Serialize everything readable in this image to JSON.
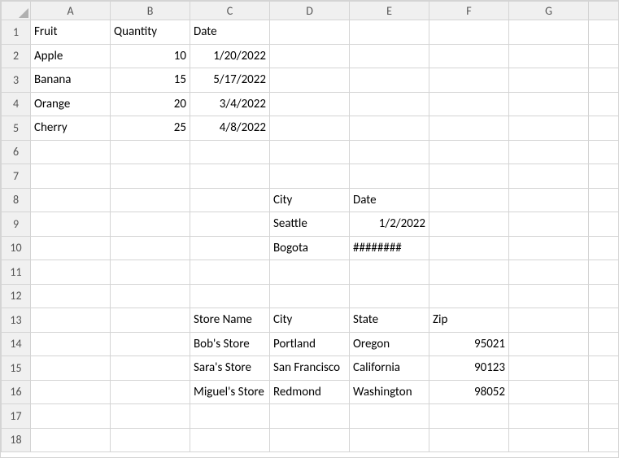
{
  "columns": [
    "A",
    "B",
    "C",
    "D",
    "E",
    "F",
    "G"
  ],
  "rows": 18,
  "cells": {
    "A1": {
      "v": "Fruit",
      "a": "txt"
    },
    "B1": {
      "v": "Quantity",
      "a": "txt"
    },
    "C1": {
      "v": "Date",
      "a": "txt"
    },
    "A2": {
      "v": "Apple",
      "a": "txt"
    },
    "B2": {
      "v": "10",
      "a": "num"
    },
    "C2": {
      "v": "1/20/2022",
      "a": "num"
    },
    "A3": {
      "v": "Banana",
      "a": "txt"
    },
    "B3": {
      "v": "15",
      "a": "num"
    },
    "C3": {
      "v": "5/17/2022",
      "a": "num"
    },
    "A4": {
      "v": "Orange",
      "a": "txt"
    },
    "B4": {
      "v": "20",
      "a": "num"
    },
    "C4": {
      "v": "3/4/2022",
      "a": "num"
    },
    "A5": {
      "v": "Cherry",
      "a": "txt"
    },
    "B5": {
      "v": "25",
      "a": "num"
    },
    "C5": {
      "v": "4/8/2022",
      "a": "num"
    },
    "D8": {
      "v": "City",
      "a": "txt"
    },
    "E8": {
      "v": "Date",
      "a": "txt"
    },
    "D9": {
      "v": "Seattle",
      "a": "txt"
    },
    "E9": {
      "v": "1/2/2022",
      "a": "num"
    },
    "D10": {
      "v": "Bogota",
      "a": "txt"
    },
    "E10": {
      "v": "########",
      "a": "txt"
    },
    "C13": {
      "v": "Store Name",
      "a": "txt"
    },
    "D13": {
      "v": "City",
      "a": "txt"
    },
    "E13": {
      "v": "State",
      "a": "txt"
    },
    "F13": {
      "v": "Zip",
      "a": "txt"
    },
    "C14": {
      "v": "Bob's Store",
      "a": "txt"
    },
    "D14": {
      "v": "Portland",
      "a": "txt"
    },
    "E14": {
      "v": "Oregon",
      "a": "txt"
    },
    "F14": {
      "v": "95021",
      "a": "num"
    },
    "C15": {
      "v": "Sara's Store",
      "a": "txt"
    },
    "D15": {
      "v": "San Francisco",
      "a": "txt"
    },
    "E15": {
      "v": "California",
      "a": "txt"
    },
    "F15": {
      "v": "90123",
      "a": "num"
    },
    "C16": {
      "v": "Miguel's Store",
      "a": "txt"
    },
    "D16": {
      "v": "Redmond",
      "a": "txt"
    },
    "E16": {
      "v": "Washington",
      "a": "txt"
    },
    "F16": {
      "v": "98052",
      "a": "num"
    }
  }
}
